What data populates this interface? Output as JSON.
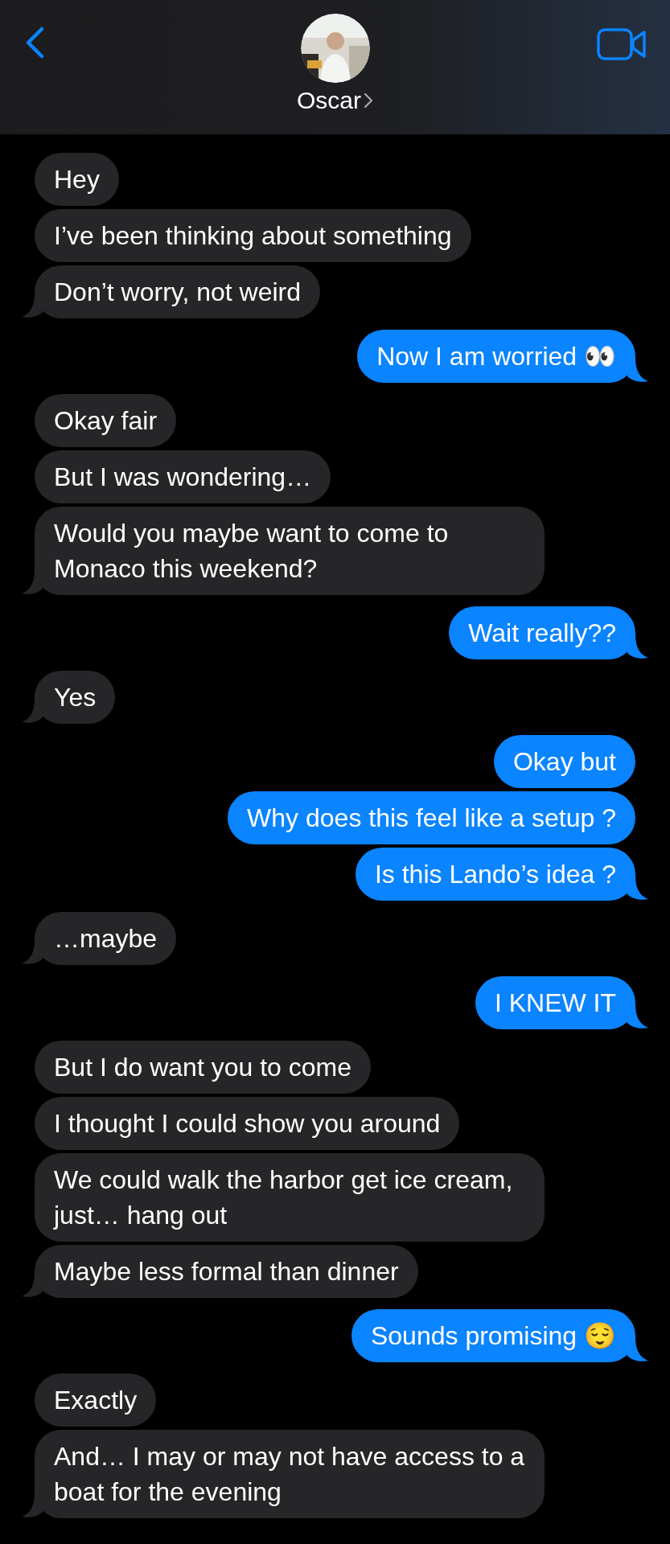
{
  "header": {
    "contact_name": "Oscar"
  },
  "groups": [
    {
      "kind": "received",
      "messages": [
        "Hey",
        "I’ve been thinking about something",
        "Don’t worry, not weird"
      ]
    },
    {
      "kind": "sent",
      "messages": [
        "Now I am worried 👀"
      ]
    },
    {
      "kind": "received",
      "messages": [
        "Okay fair",
        "But I was wondering…",
        "Would you maybe want to come to Monaco this weekend?"
      ]
    },
    {
      "kind": "sent",
      "messages": [
        "Wait really??"
      ]
    },
    {
      "kind": "received",
      "messages": [
        "Yes"
      ]
    },
    {
      "kind": "sent",
      "messages": [
        "Okay but",
        "Why does this feel like a setup ?",
        "Is this Lando’s idea ?"
      ]
    },
    {
      "kind": "received",
      "messages": [
        "…maybe"
      ]
    },
    {
      "kind": "sent",
      "messages": [
        "I KNEW IT"
      ]
    },
    {
      "kind": "received",
      "messages": [
        "But I do want you to come",
        "I thought I could show you around",
        "We could walk the harbor get ice cream, just… hang out",
        "Maybe less formal than dinner"
      ]
    },
    {
      "kind": "sent",
      "messages": [
        "Sounds promising 😌"
      ]
    },
    {
      "kind": "received",
      "messages": [
        "Exactly",
        "And… I may or may not have access to a boat for the evening"
      ]
    }
  ]
}
